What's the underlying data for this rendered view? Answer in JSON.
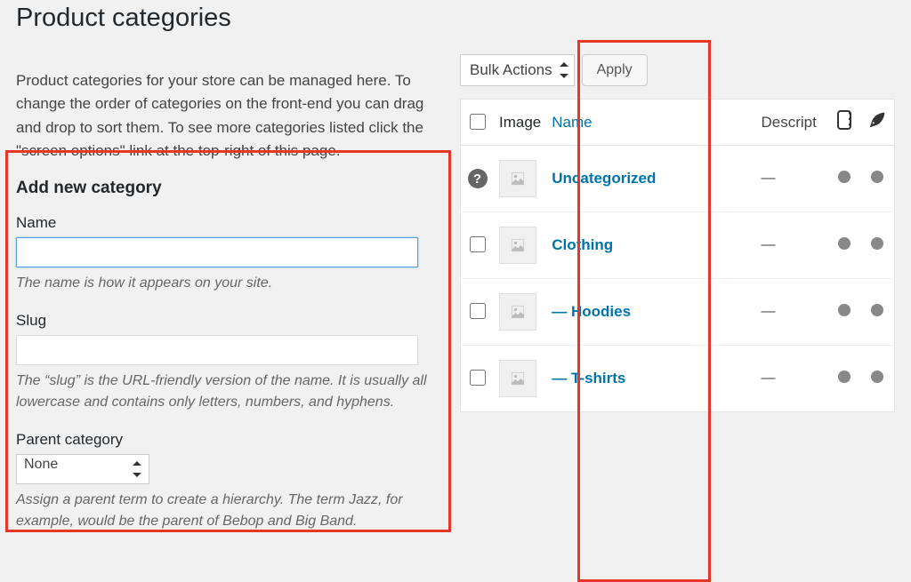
{
  "page_title": "Product categories",
  "intro_text": "Product categories for your store can be managed here. To change the order of categories on the front-end you can drag and drop to sort them. To see more categories listed click the \"screen options\" link at the top-right of this page.",
  "form": {
    "heading": "Add new category",
    "name": {
      "label": "Name",
      "value": "",
      "help": "The name is how it appears on your site."
    },
    "slug": {
      "label": "Slug",
      "value": "",
      "help": "The “slug” is the URL-friendly version of the name. It is usually all lowercase and contains only letters, numbers, and hyphens."
    },
    "parent": {
      "label": "Parent category",
      "selected": "None",
      "help": "Assign a parent term to create a hierarchy. The term Jazz, for example, would be the parent of Bebop and Big Band."
    }
  },
  "bulk": {
    "label": "Bulk Actions",
    "apply": "Apply"
  },
  "table": {
    "headers": {
      "image": "Image",
      "name": "Name",
      "description": "Descript"
    },
    "rows": [
      {
        "name": "Uncategorized",
        "indent": false,
        "description": "—",
        "no_checkbox": true,
        "help_icon": true
      },
      {
        "name": "Clothing",
        "indent": false,
        "description": "—"
      },
      {
        "name": "Hoodies",
        "indent": true,
        "description": "—"
      },
      {
        "name": "T-shirts",
        "indent": true,
        "description": "—"
      }
    ],
    "indent_prefix": "— "
  }
}
